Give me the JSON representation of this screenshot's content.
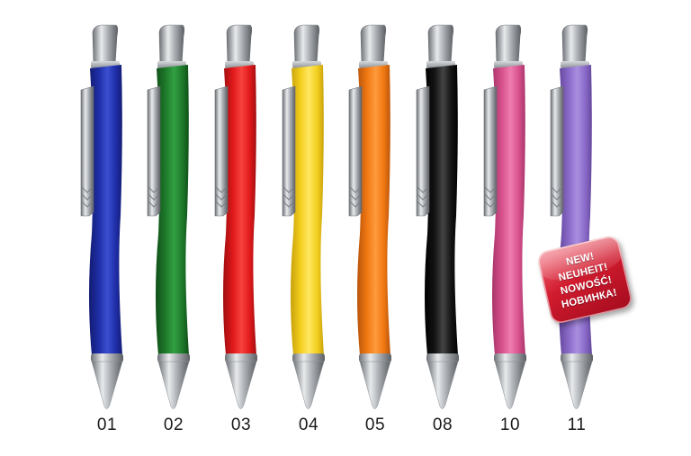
{
  "pens": [
    {
      "number": "01",
      "color": "#1f2ea8",
      "light": "#3a4fcf",
      "dark": "#121c72"
    },
    {
      "number": "02",
      "color": "#1e7a2a",
      "light": "#33a044",
      "dark": "#0f4f18"
    },
    {
      "number": "03",
      "color": "#e0191b",
      "light": "#f8423e",
      "dark": "#a10e10"
    },
    {
      "number": "04",
      "color": "#f3cf1e",
      "light": "#ffe760",
      "dark": "#c9a10a"
    },
    {
      "number": "05",
      "color": "#f07812",
      "light": "#ff9a3c",
      "dark": "#b9540a"
    },
    {
      "number": "08",
      "color": "#141414",
      "light": "#444444",
      "dark": "#000000"
    },
    {
      "number": "10",
      "color": "#d8528d",
      "light": "#ee7cae",
      "dark": "#a8356a"
    },
    {
      "number": "11",
      "color": "#8a6ac8",
      "light": "#a98ee0",
      "dark": "#63469c"
    }
  ],
  "badge": {
    "lines": [
      "NEW!",
      "NEUHEIT!",
      "NOWOŚĆ!",
      "НОВИНКА!"
    ],
    "color": "#d11b2e"
  },
  "metal_color": "#b8bcc0"
}
